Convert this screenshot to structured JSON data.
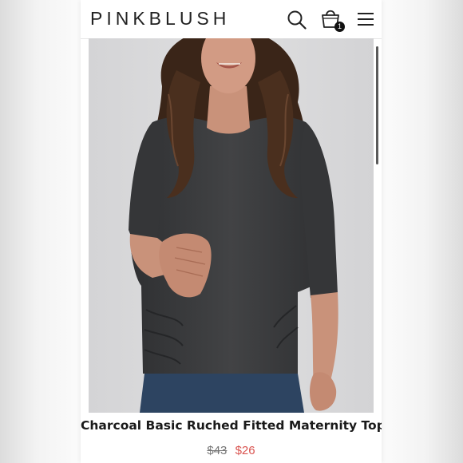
{
  "brand": {
    "name": "PINKBLUSH"
  },
  "header": {
    "icons": [
      "search-icon",
      "shopping-bag-icon",
      "menu-icon"
    ],
    "cart_count": "1"
  },
  "product": {
    "image_alt": "model wearing charcoal ruched maternity top",
    "title": "Charcoal Basic Ruched Fitted Maternity Top",
    "original_price": "$43",
    "sale_price": "$26"
  },
  "colors": {
    "sale_price": "#d9534f",
    "text": "#1a1a1a",
    "top": "#3a3b3d"
  }
}
